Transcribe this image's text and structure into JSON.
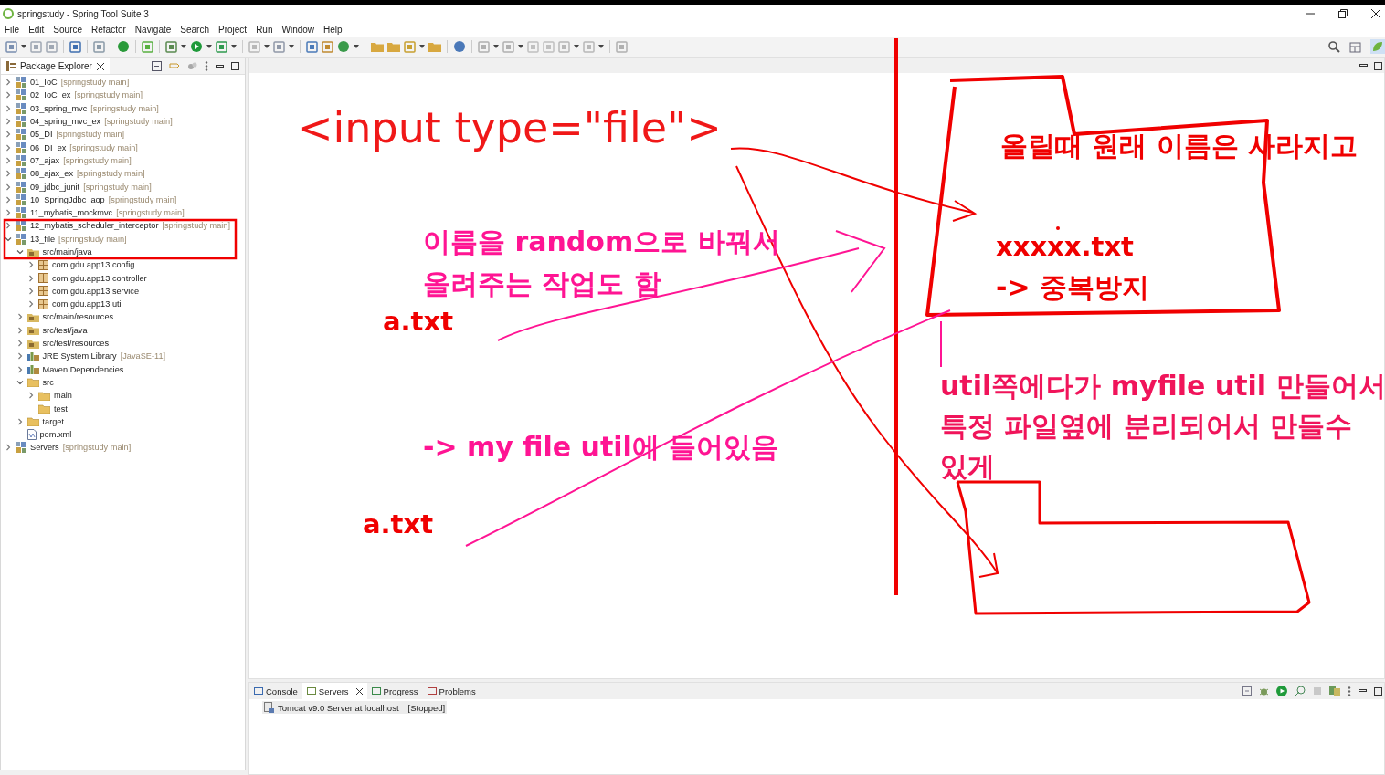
{
  "window": {
    "title": "springstudy - Spring Tool Suite 3"
  },
  "menu": [
    "File",
    "Edit",
    "Source",
    "Refactor",
    "Navigate",
    "Search",
    "Project",
    "Run",
    "Window",
    "Help"
  ],
  "explorer": {
    "title": "Package Explorer",
    "items": [
      {
        "label": "01_IoC",
        "decoration": "[springstudy main]",
        "kind": "project",
        "expanded": false
      },
      {
        "label": "02_IoC_ex",
        "decoration": "[springstudy main]",
        "kind": "project",
        "expanded": false
      },
      {
        "label": "03_spring_mvc",
        "decoration": "[springstudy main]",
        "kind": "project",
        "expanded": false
      },
      {
        "label": "04_spring_mvc_ex",
        "decoration": "[springstudy main]",
        "kind": "project",
        "expanded": false
      },
      {
        "label": "05_DI",
        "decoration": "[springstudy main]",
        "kind": "project",
        "expanded": false
      },
      {
        "label": "06_DI_ex",
        "decoration": "[springstudy main]",
        "kind": "project",
        "expanded": false
      },
      {
        "label": "07_ajax",
        "decoration": "[springstudy main]",
        "kind": "project",
        "expanded": false
      },
      {
        "label": "08_ajax_ex",
        "decoration": "[springstudy main]",
        "kind": "project",
        "expanded": false
      },
      {
        "label": "09_jdbc_junit",
        "decoration": "[springstudy main]",
        "kind": "project",
        "expanded": false
      },
      {
        "label": "10_SpringJdbc_aop",
        "decoration": "[springstudy main]",
        "kind": "project",
        "expanded": false
      },
      {
        "label": "11_mybatis_mockmvc",
        "decoration": "[springstudy main]",
        "kind": "project",
        "expanded": false
      },
      {
        "label": "12_mybatis_scheduler_interceptor",
        "decoration": "[springstudy main]",
        "kind": "project",
        "expanded": false
      },
      {
        "label": "13_file",
        "decoration": "[springstudy main]",
        "kind": "project",
        "expanded": true,
        "children": [
          {
            "label": "src/main/java",
            "kind": "source-folder",
            "expanded": true,
            "children": [
              {
                "label": "com.gdu.app13.config",
                "kind": "package",
                "expanded": false
              },
              {
                "label": "com.gdu.app13.controller",
                "kind": "package",
                "expanded": false
              },
              {
                "label": "com.gdu.app13.service",
                "kind": "package",
                "expanded": false
              },
              {
                "label": "com.gdu.app13.util",
                "kind": "package",
                "expanded": false
              }
            ]
          },
          {
            "label": "src/main/resources",
            "kind": "source-folder",
            "expanded": false
          },
          {
            "label": "src/test/java",
            "kind": "source-folder",
            "expanded": false
          },
          {
            "label": "src/test/resources",
            "kind": "source-folder",
            "expanded": false
          },
          {
            "label": "JRE System Library",
            "decoration": "[JavaSE-11]",
            "kind": "library",
            "expanded": false
          },
          {
            "label": "Maven Dependencies",
            "kind": "library",
            "expanded": false
          },
          {
            "label": "src",
            "kind": "folder",
            "expanded": true,
            "children": [
              {
                "label": "main",
                "kind": "folder",
                "expanded": false
              },
              {
                "label": "test",
                "kind": "folder"
              }
            ]
          },
          {
            "label": "target",
            "kind": "folder",
            "expanded": false
          },
          {
            "label": "pom.xml",
            "kind": "file"
          }
        ]
      },
      {
        "label": "Servers",
        "decoration": "[springstudy main]",
        "kind": "project",
        "expanded": false
      }
    ]
  },
  "annotations": [
    {
      "text": "<input type=\"file\">",
      "color": "#f01818"
    },
    {
      "text": "이름을 random으로 바꿔서",
      "color": "#ff1493"
    },
    {
      "text": "올려주는 작업도 함",
      "color": "#ff1493"
    },
    {
      "text": "a.txt",
      "color": "#f00000"
    },
    {
      "text": "-> my file util에 들어있음",
      "color": "#ff1493"
    },
    {
      "text": "a.txt",
      "color": "#f00000"
    },
    {
      "text": "올릴때 원래 이름은 사라지고",
      "color": "#f00000"
    },
    {
      "text": "xxxxx.txt",
      "color": "#f00000"
    },
    {
      "text": "-> 중복방지",
      "color": "#f00000"
    },
    {
      "text": "util쪽에다가 myfile util 만들어서",
      "color": "#f0145a"
    },
    {
      "text": "특정 파일옆에 분리되어서 만들수",
      "color": "#f0145a"
    },
    {
      "text": "있게",
      "color": "#f0145a"
    }
  ],
  "bottom": {
    "tabs": [
      {
        "label": "Console",
        "selected": false
      },
      {
        "label": "Servers",
        "selected": true
      },
      {
        "label": "Progress",
        "selected": false
      },
      {
        "label": "Problems",
        "selected": false
      }
    ],
    "servers": [
      {
        "name": "Tomcat v9.0 Server at localhost",
        "status": "[Stopped]"
      }
    ]
  }
}
